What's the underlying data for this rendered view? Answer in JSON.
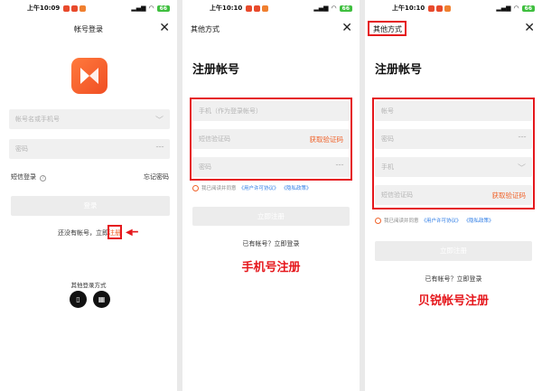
{
  "panels": [
    {
      "status": {
        "time": "上午10:09",
        "battery": "66"
      },
      "nav": {
        "title": "帐号登录"
      },
      "account_placeholder": "帐号名或手机号",
      "password_placeholder": "密码",
      "sms_login": "短信登录",
      "forgot": "忘记密码",
      "login_button": "登录",
      "register_prompt": "还没有帐号，立即",
      "register_link": "注册",
      "other_methods": "其他登录方式",
      "icons": [
        "phone-icon",
        "qr-code-icon"
      ]
    },
    {
      "status": {
        "time": "上午10:10",
        "battery": "66"
      },
      "nav": {
        "title": "其他方式"
      },
      "heading": "注册帐号",
      "phone_placeholder": "手机（作为登录帐号）",
      "sms_placeholder": "短信验证码",
      "get_code": "获取验证码",
      "password_placeholder": "密码",
      "agree_prefix": "我已阅读并同意",
      "agree_link1": "《用户许可协议》",
      "agree_link2": "《隐私政策》",
      "register_button": "立即注册",
      "has_account": "已有帐号？立即登录",
      "caption": "手机号注册"
    },
    {
      "status": {
        "time": "上午10:10",
        "battery": "66"
      },
      "nav": {
        "title": "其他方式"
      },
      "heading": "注册帐号",
      "account_placeholder": "帐号",
      "password_placeholder": "密码",
      "phone_placeholder": "手机",
      "sms_placeholder": "短信验证码",
      "get_code": "获取验证码",
      "agree_prefix": "我已阅读并同意",
      "agree_link1": "《用户许可协议》",
      "agree_link2": "《隐私政策》",
      "register_button": "立即注册",
      "has_account": "已有帐号？立即登录",
      "caption": "贝锐帐号注册"
    }
  ],
  "colors": {
    "accent": "#f0632b",
    "annotation": "#e5171c",
    "link": "#2c7be5"
  }
}
